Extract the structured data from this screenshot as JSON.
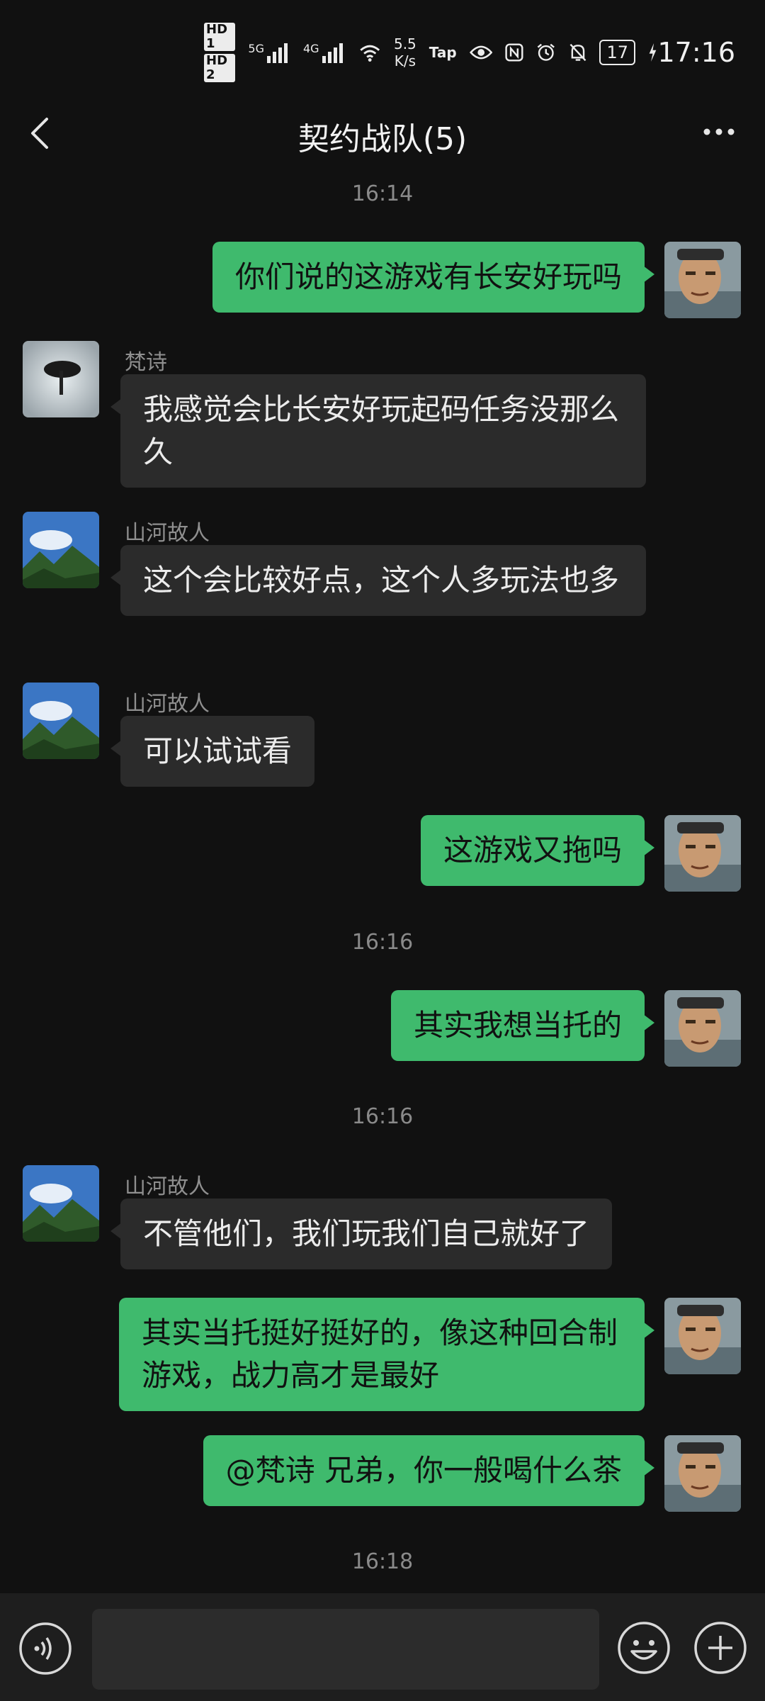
{
  "status_bar": {
    "hd1": "HD 1",
    "hd2": "HD 2",
    "net5g": "5G",
    "net4g": "4G",
    "speed_value": "5.5",
    "speed_unit": "K/s",
    "tap": "Tap",
    "battery": "17",
    "time": "17:16"
  },
  "header": {
    "title": "契约战队(5)"
  },
  "timestamps": [
    "16:14",
    "16:16",
    "16:16",
    "16:18"
  ],
  "messages": [
    {
      "side": "out",
      "text": "你们说的这游戏有长安好玩吗"
    },
    {
      "side": "in",
      "sender": "梵诗",
      "text": "我感觉会比长安好玩起码任务没那么久"
    },
    {
      "side": "in",
      "sender": "山河故人",
      "text": "这个会比较好点，这个人多玩法也多"
    },
    {
      "side": "in",
      "sender": "山河故人",
      "text": "可以试试看"
    },
    {
      "side": "out",
      "text": "这游戏又拖吗"
    },
    {
      "side": "out",
      "text": "其实我想当托的"
    },
    {
      "side": "in",
      "sender": "山河故人",
      "text": "不管他们，我们玩我们自己就好了"
    },
    {
      "side": "out",
      "text": "其实当托挺好挺好的，像这种回合制游戏，战力高才是最好"
    },
    {
      "side": "out",
      "text": "@梵诗  兄弟，你一般喝什么茶"
    }
  ],
  "colors": {
    "background": "#111111",
    "outgoing_bubble": "#3fba6d",
    "incoming_bubble": "#2b2b2b",
    "bottom_bar": "#1e1e1e"
  },
  "icons": {
    "back": "chevron-left-icon",
    "more": "more-dots-icon",
    "voice": "voice-icon",
    "emoji": "emoji-icon",
    "plus": "plus-icon"
  }
}
